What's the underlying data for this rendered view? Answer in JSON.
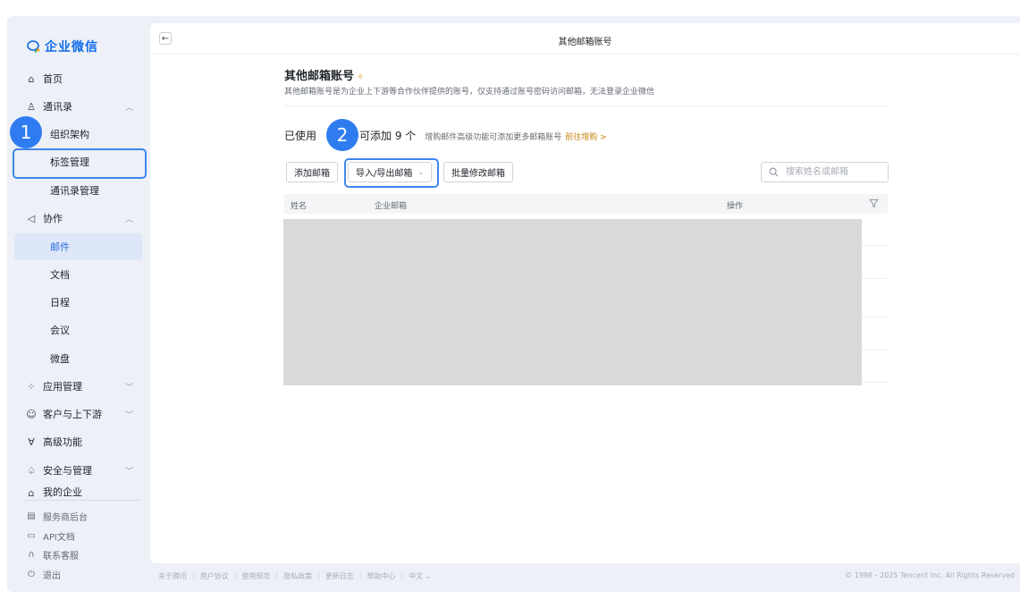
{
  "sidebar": {
    "logo_text": "企业微信",
    "items": [
      {
        "label": "首页",
        "icon": "home-icon"
      },
      {
        "label": "通讯录",
        "icon": "contacts-icon",
        "chevron": "︿"
      },
      {
        "label": "组织架构"
      },
      {
        "label": "标签管理"
      },
      {
        "label": "通讯录管理"
      },
      {
        "label": "协作",
        "icon": "collab-icon",
        "chevron": "︿"
      },
      {
        "label": "邮件"
      },
      {
        "label": "文档"
      },
      {
        "label": "日程"
      },
      {
        "label": "会议"
      },
      {
        "label": "微盘"
      },
      {
        "label": "应用管理",
        "icon": "apps-icon",
        "chevron": "﹀"
      },
      {
        "label": "客户与上下游",
        "icon": "customer-icon",
        "chevron": "﹀"
      },
      {
        "label": "高级功能",
        "icon": "advanced-icon"
      },
      {
        "label": "安全与管理",
        "icon": "security-icon",
        "chevron": "﹀"
      },
      {
        "label": "我的企业",
        "icon": "company-icon"
      }
    ],
    "bottom_items": [
      {
        "label": "服务商后台",
        "icon": "service-icon"
      },
      {
        "label": "API文档",
        "icon": "api-icon"
      },
      {
        "label": "联系客服",
        "icon": "support-icon"
      },
      {
        "label": "退出",
        "icon": "power-icon"
      }
    ]
  },
  "main": {
    "topbar_title": "其他邮箱账号",
    "page_title": "其他邮箱账号",
    "page_desc": "其他邮箱账号是为企业上下游等合作伙伴提供的账号，仅支持通过账号密码访问邮箱，无法登录企业微信",
    "usage_prefix": "已使用",
    "usage_rest": "可添加 9 个",
    "usage_hint": "增购邮件高级功能可添加更多邮箱账号",
    "usage_link": "前往增购 >",
    "toolbar": {
      "add_label": "添加邮箱",
      "import_export_label": "导入/导出邮箱",
      "batch_label": "批量修改邮箱",
      "search_placeholder": "搜索姓名或邮箱"
    },
    "table": {
      "columns": [
        "姓名",
        "企业邮箱",
        "操作"
      ]
    }
  },
  "footer": {
    "links": [
      "关于腾讯",
      "用户协议",
      "使用规范",
      "隐私政策",
      "更新日志",
      "帮助中心",
      "中文 ⌄"
    ],
    "copyright": "© 1998 - 2025 Tencent Inc. All Rights Reserved"
  },
  "annotations": {
    "badge1": "1",
    "badge2": "2"
  },
  "colors": {
    "brand": "#0f6be9",
    "annotation": "#2f7cf0",
    "active_bg": "#dde7f8",
    "link_orange": "#c7800e"
  }
}
